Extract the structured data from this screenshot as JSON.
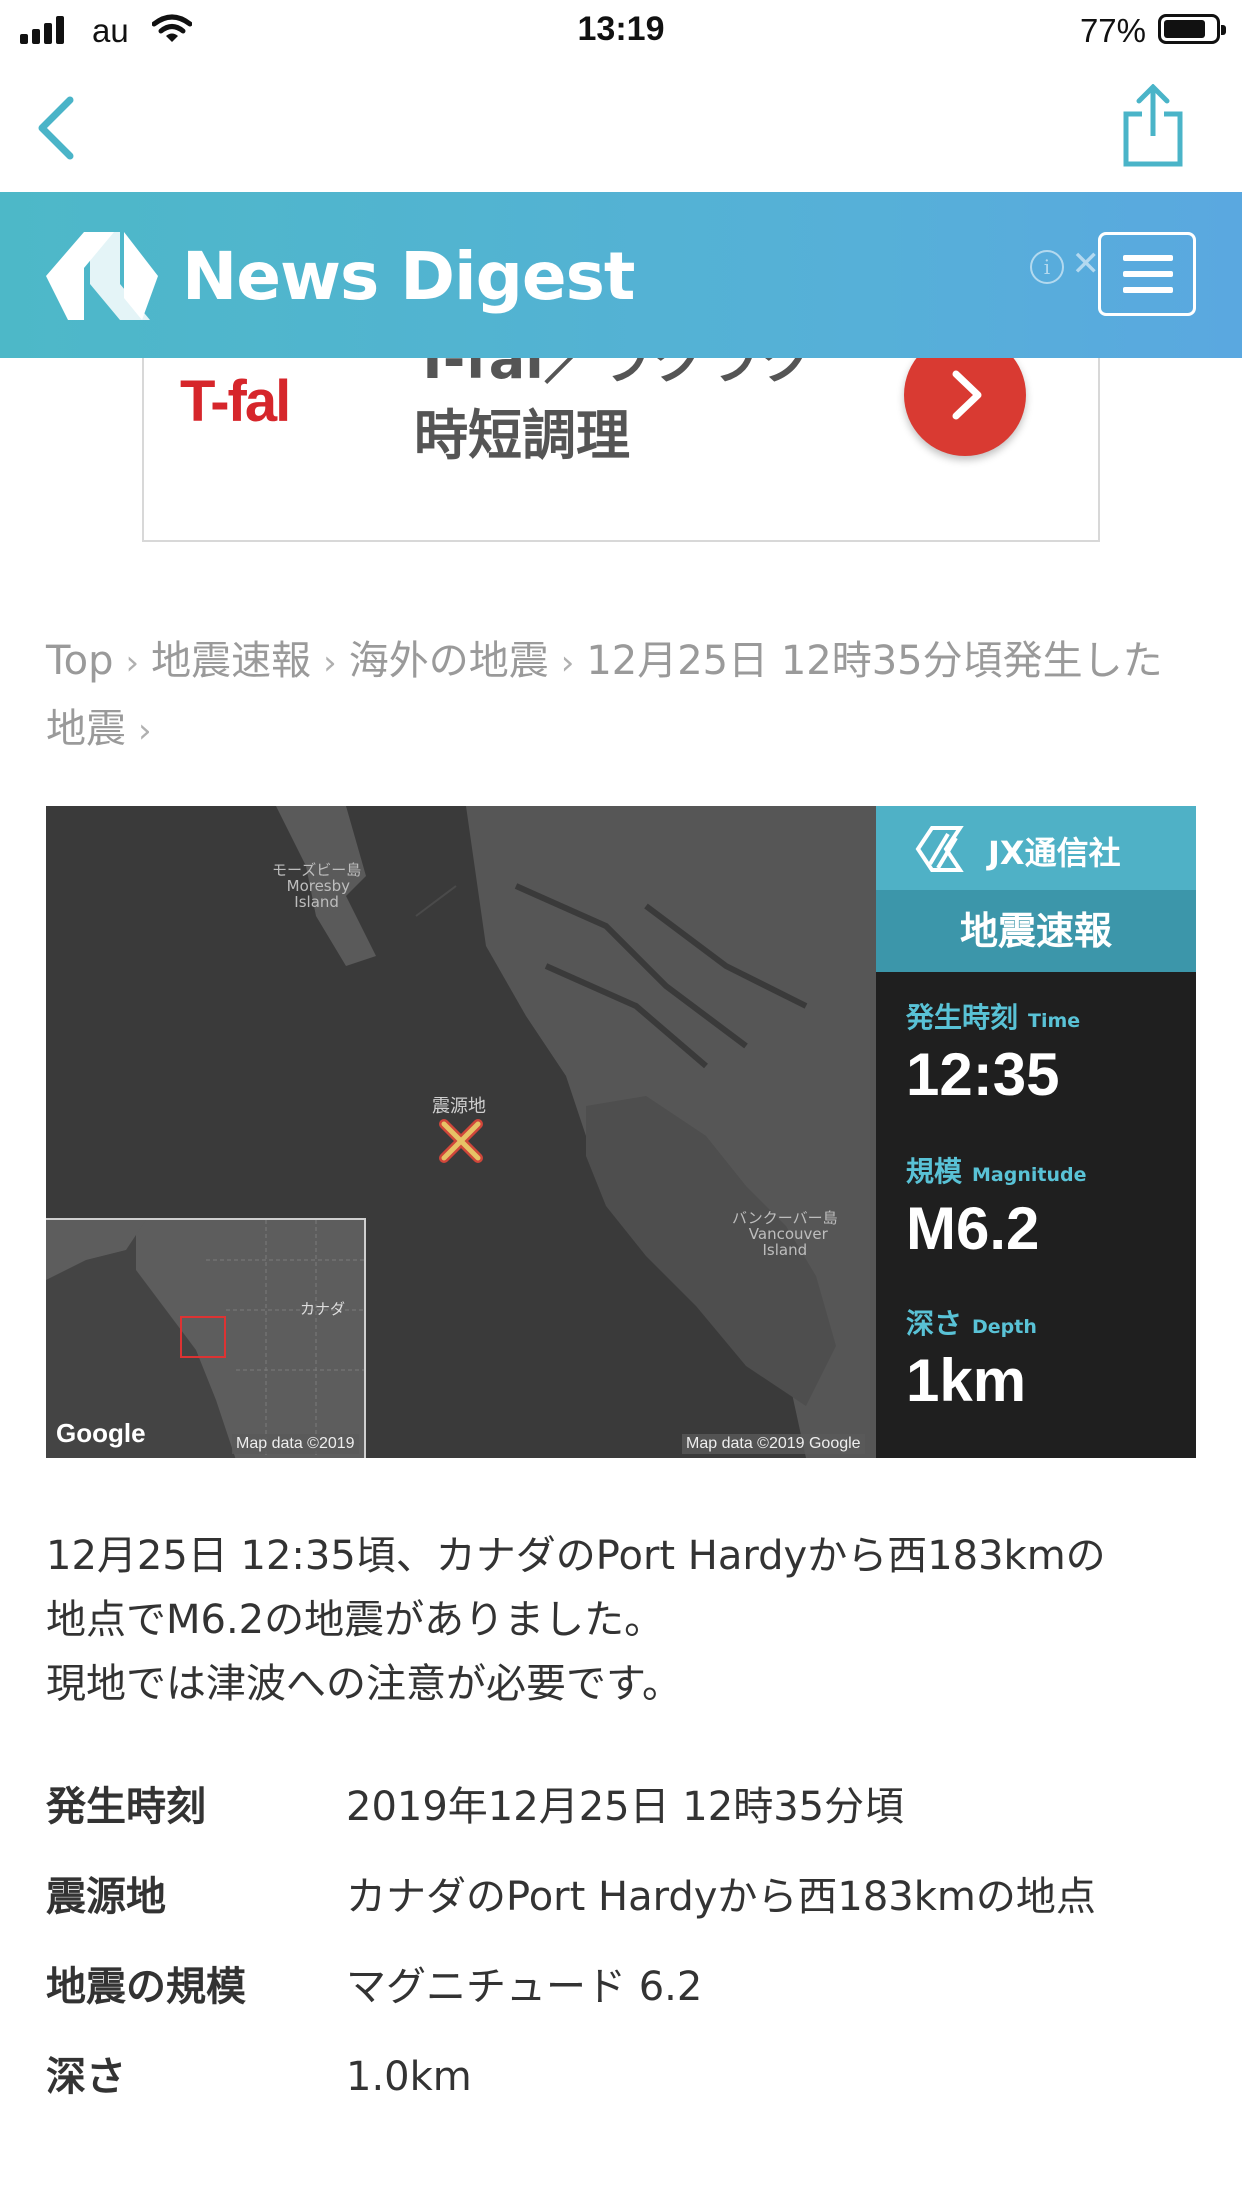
{
  "status_bar": {
    "carrier": "au",
    "time": "13:19",
    "battery": "77%"
  },
  "site": {
    "logo_text": "News Digest"
  },
  "ad": {
    "brand": "T-fal",
    "line1": "T-fal／ラクラク",
    "line2": "時短調理"
  },
  "breadcrumb": {
    "items": [
      "Top",
      "地震速報",
      "海外の地震",
      "12月25日 12時35分頃発生した地震"
    ]
  },
  "map": {
    "epicenter_label": "震源地",
    "label_moresby_jp": "モーズビー島",
    "label_moresby_en": "Moresby Island",
    "label_vancouver_jp": "バンクーバー島",
    "label_vancouver_en": "Vancouver Island",
    "inset_label": "カナダ",
    "google": "Google",
    "attribution_inset": "Map data ©2019",
    "attribution_main": "Map data ©2019 Google",
    "panel": {
      "agency": "JX通信社",
      "title": "地震速報",
      "time_label": "発生時刻",
      "time_label_en": "Time",
      "time_value": "12:35",
      "mag_label": "規模",
      "mag_label_en": "Magnitude",
      "mag_value": "M6.2",
      "depth_label": "深さ",
      "depth_label_en": "Depth",
      "depth_value": "1km"
    }
  },
  "summary": {
    "line1": "12月25日 12:35頃、カナダのPort Hardyから西183kmの",
    "line2": "地点でM6.2の地震がありました。",
    "line3": "現地では津波への注意が必要です。"
  },
  "details": [
    {
      "label": "発生時刻",
      "value": "2019年12月25日 12時35分頃"
    },
    {
      "label": "震源地",
      "value": "カナダのPort Hardyから西183kmの地点"
    },
    {
      "label": "地震の規模",
      "value": "マグニチュード 6.2"
    },
    {
      "label": "深さ",
      "value": "1.0km"
    }
  ],
  "colors": {
    "accent": "#4db8c8",
    "ad_red": "#d93a32",
    "panel_teal": "#59c2d6"
  }
}
